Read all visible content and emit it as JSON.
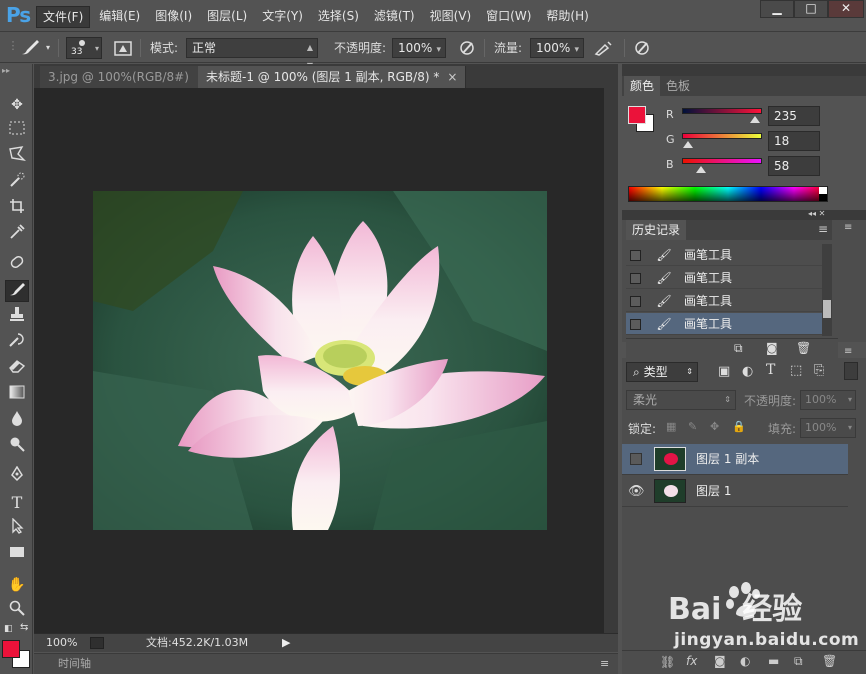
{
  "app": {
    "logo": "Ps"
  },
  "menu": [
    "文件(F)",
    "编辑(E)",
    "图像(I)",
    "图层(L)",
    "文字(Y)",
    "选择(S)",
    "滤镜(T)",
    "视图(V)",
    "窗口(W)",
    "帮助(H)"
  ],
  "window_controls": {
    "minimize": "▁",
    "maximize": "□",
    "close": "✕"
  },
  "options": {
    "brush_size": "33",
    "mode_label": "模式:",
    "mode_value": "正常",
    "opacity_label": "不透明度:",
    "opacity_value": "100%",
    "flow_label": "流量:",
    "flow_value": "100%"
  },
  "tabs": [
    {
      "label": "3.jpg @ 100%(RGB/8#)",
      "close": "×"
    },
    {
      "label": "未标题-1 @ 100% (图层 1 副本, RGB/8) *",
      "close": "×"
    }
  ],
  "status": {
    "zoom": "100%",
    "doc": "文档:452.2K/1.03M"
  },
  "timeline_label": "时间轴",
  "color_panel": {
    "tabs": [
      "颜色",
      "色板"
    ],
    "r_label": "R",
    "g_label": "G",
    "b_label": "B",
    "r": "235",
    "g": "18",
    "b": "58",
    "foreground": "#eb123a"
  },
  "history_panel": {
    "title": "历史记录",
    "items": [
      "画笔工具",
      "画笔工具",
      "画笔工具",
      "画笔工具"
    ]
  },
  "layers_panel": {
    "filter_label": "类型",
    "blend_mode": "柔光",
    "opacity_label": "不透明度:",
    "opacity_value": "100%",
    "lock_label": "锁定:",
    "fill_label": "填充:",
    "fill_value": "100%",
    "layers": [
      {
        "name": "图层 1 副本",
        "visible": false,
        "selected": true
      },
      {
        "name": "图层 1",
        "visible": true,
        "selected": false
      }
    ]
  },
  "watermark": {
    "brand": "Bai  经验",
    "url": "jingyan.baidu.com"
  }
}
